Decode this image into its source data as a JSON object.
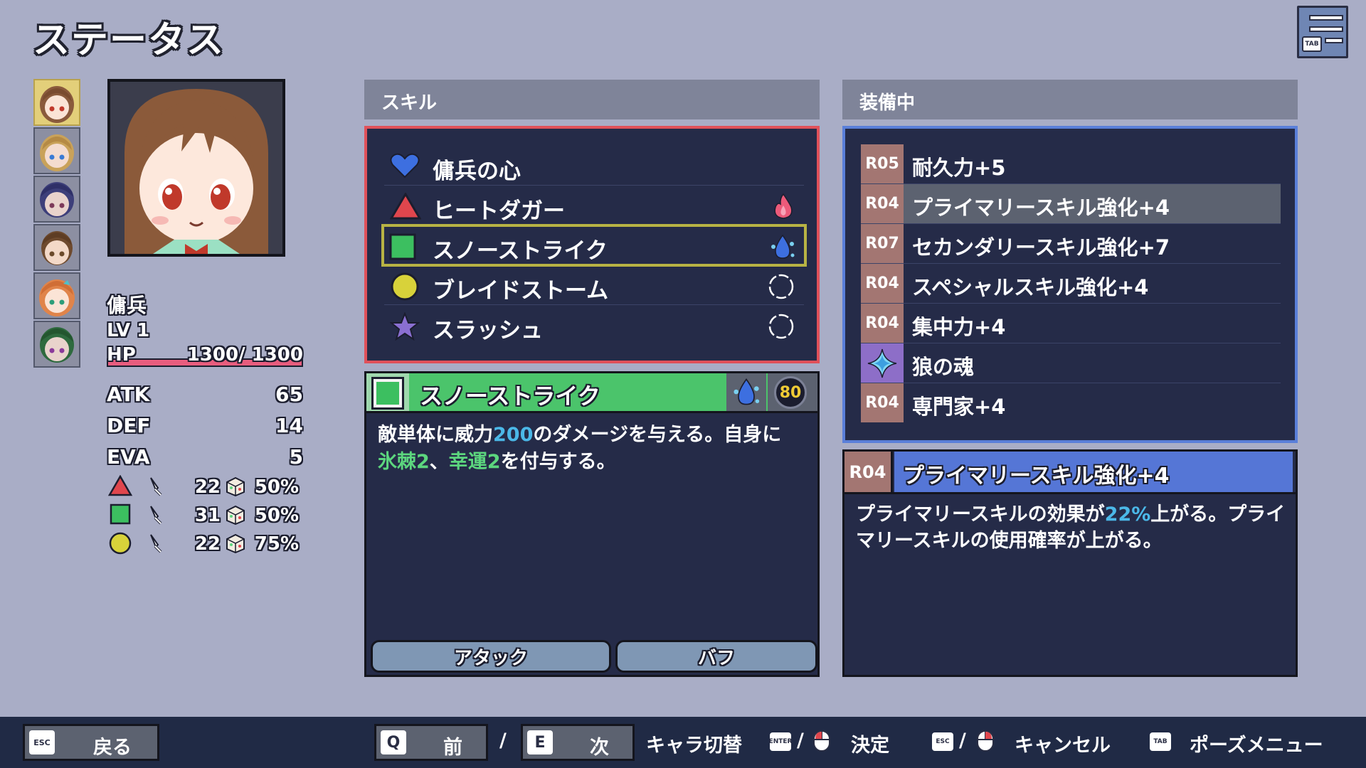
{
  "title": "ステータス",
  "menu_key": "TAB",
  "character": {
    "name": "傭兵",
    "level": "LV 1",
    "hp_label": "HP",
    "hp_text": "1300/ 1300",
    "hp_fraction": 1.0,
    "stats": [
      {
        "key": "ATK",
        "value": "65"
      },
      {
        "key": "DEF",
        "value": "14"
      },
      {
        "key": "EVA",
        "value": "5"
      }
    ],
    "elements": [
      {
        "shape": "triangle-red",
        "atk": "22",
        "rate": "50%"
      },
      {
        "shape": "square-green",
        "atk": "31",
        "rate": "50%"
      },
      {
        "shape": "circle-yellow",
        "atk": "22",
        "rate": "75%"
      }
    ]
  },
  "skills": {
    "header": "スキル",
    "items": [
      {
        "name": "傭兵の心",
        "icon": "heart-blue",
        "element": ""
      },
      {
        "name": "ヒートダガー",
        "icon": "triangle-red",
        "element": "fire"
      },
      {
        "name": "スノーストライク",
        "icon": "square-green",
        "element": "water"
      },
      {
        "name": "ブレイドストーム",
        "icon": "circle-yellow",
        "element": "none"
      },
      {
        "name": "スラッシュ",
        "icon": "star-purple",
        "element": "none"
      }
    ],
    "selected_index": 2
  },
  "skill_detail": {
    "name": "スノーストライク",
    "cost": "80",
    "desc_part1": "敵単体に威力",
    "desc_power": "200",
    "desc_part2": "のダメージを与える。自身に",
    "desc_buff1": "氷棘2",
    "desc_sep": "、",
    "desc_buff2": "幸運2",
    "desc_part3": "を付与する。",
    "tags": [
      "アタック",
      "バフ"
    ]
  },
  "equipment": {
    "header": "装備中",
    "items": [
      {
        "rank": "R05",
        "name": "耐久力+5"
      },
      {
        "rank": "R04",
        "name": "プライマリースキル強化+4"
      },
      {
        "rank": "R07",
        "name": "セカンダリースキル強化+7"
      },
      {
        "rank": "R04",
        "name": "スペシャルスキル強化+4"
      },
      {
        "rank": "R04",
        "name": "集中力+4"
      },
      {
        "rank": "",
        "name": "狼の魂"
      },
      {
        "rank": "R04",
        "name": "専門家+4"
      }
    ],
    "selected_index": 1
  },
  "equip_detail": {
    "rank": "R04",
    "name": "プライマリースキル強化+4",
    "desc_part1": "プライマリースキルの効果が",
    "desc_value": "22%",
    "desc_part2": "上がる。プライマリースキルの使用確率が上がる。"
  },
  "footer": {
    "back_key": "ESC",
    "back_label": "戻る",
    "prev_key": "Q",
    "prev_label": "前",
    "slash1": "/",
    "next_key": "E",
    "next_label": "次",
    "switch_label": "キャラ切替",
    "enter_key": "ENTER",
    "slash2": "/",
    "confirm_label": "決定",
    "esc_key": "ESC",
    "slash3": "/",
    "cancel_label": "キャンセル",
    "tab_key": "TAB",
    "pause_label": "ポーズメニュー"
  }
}
